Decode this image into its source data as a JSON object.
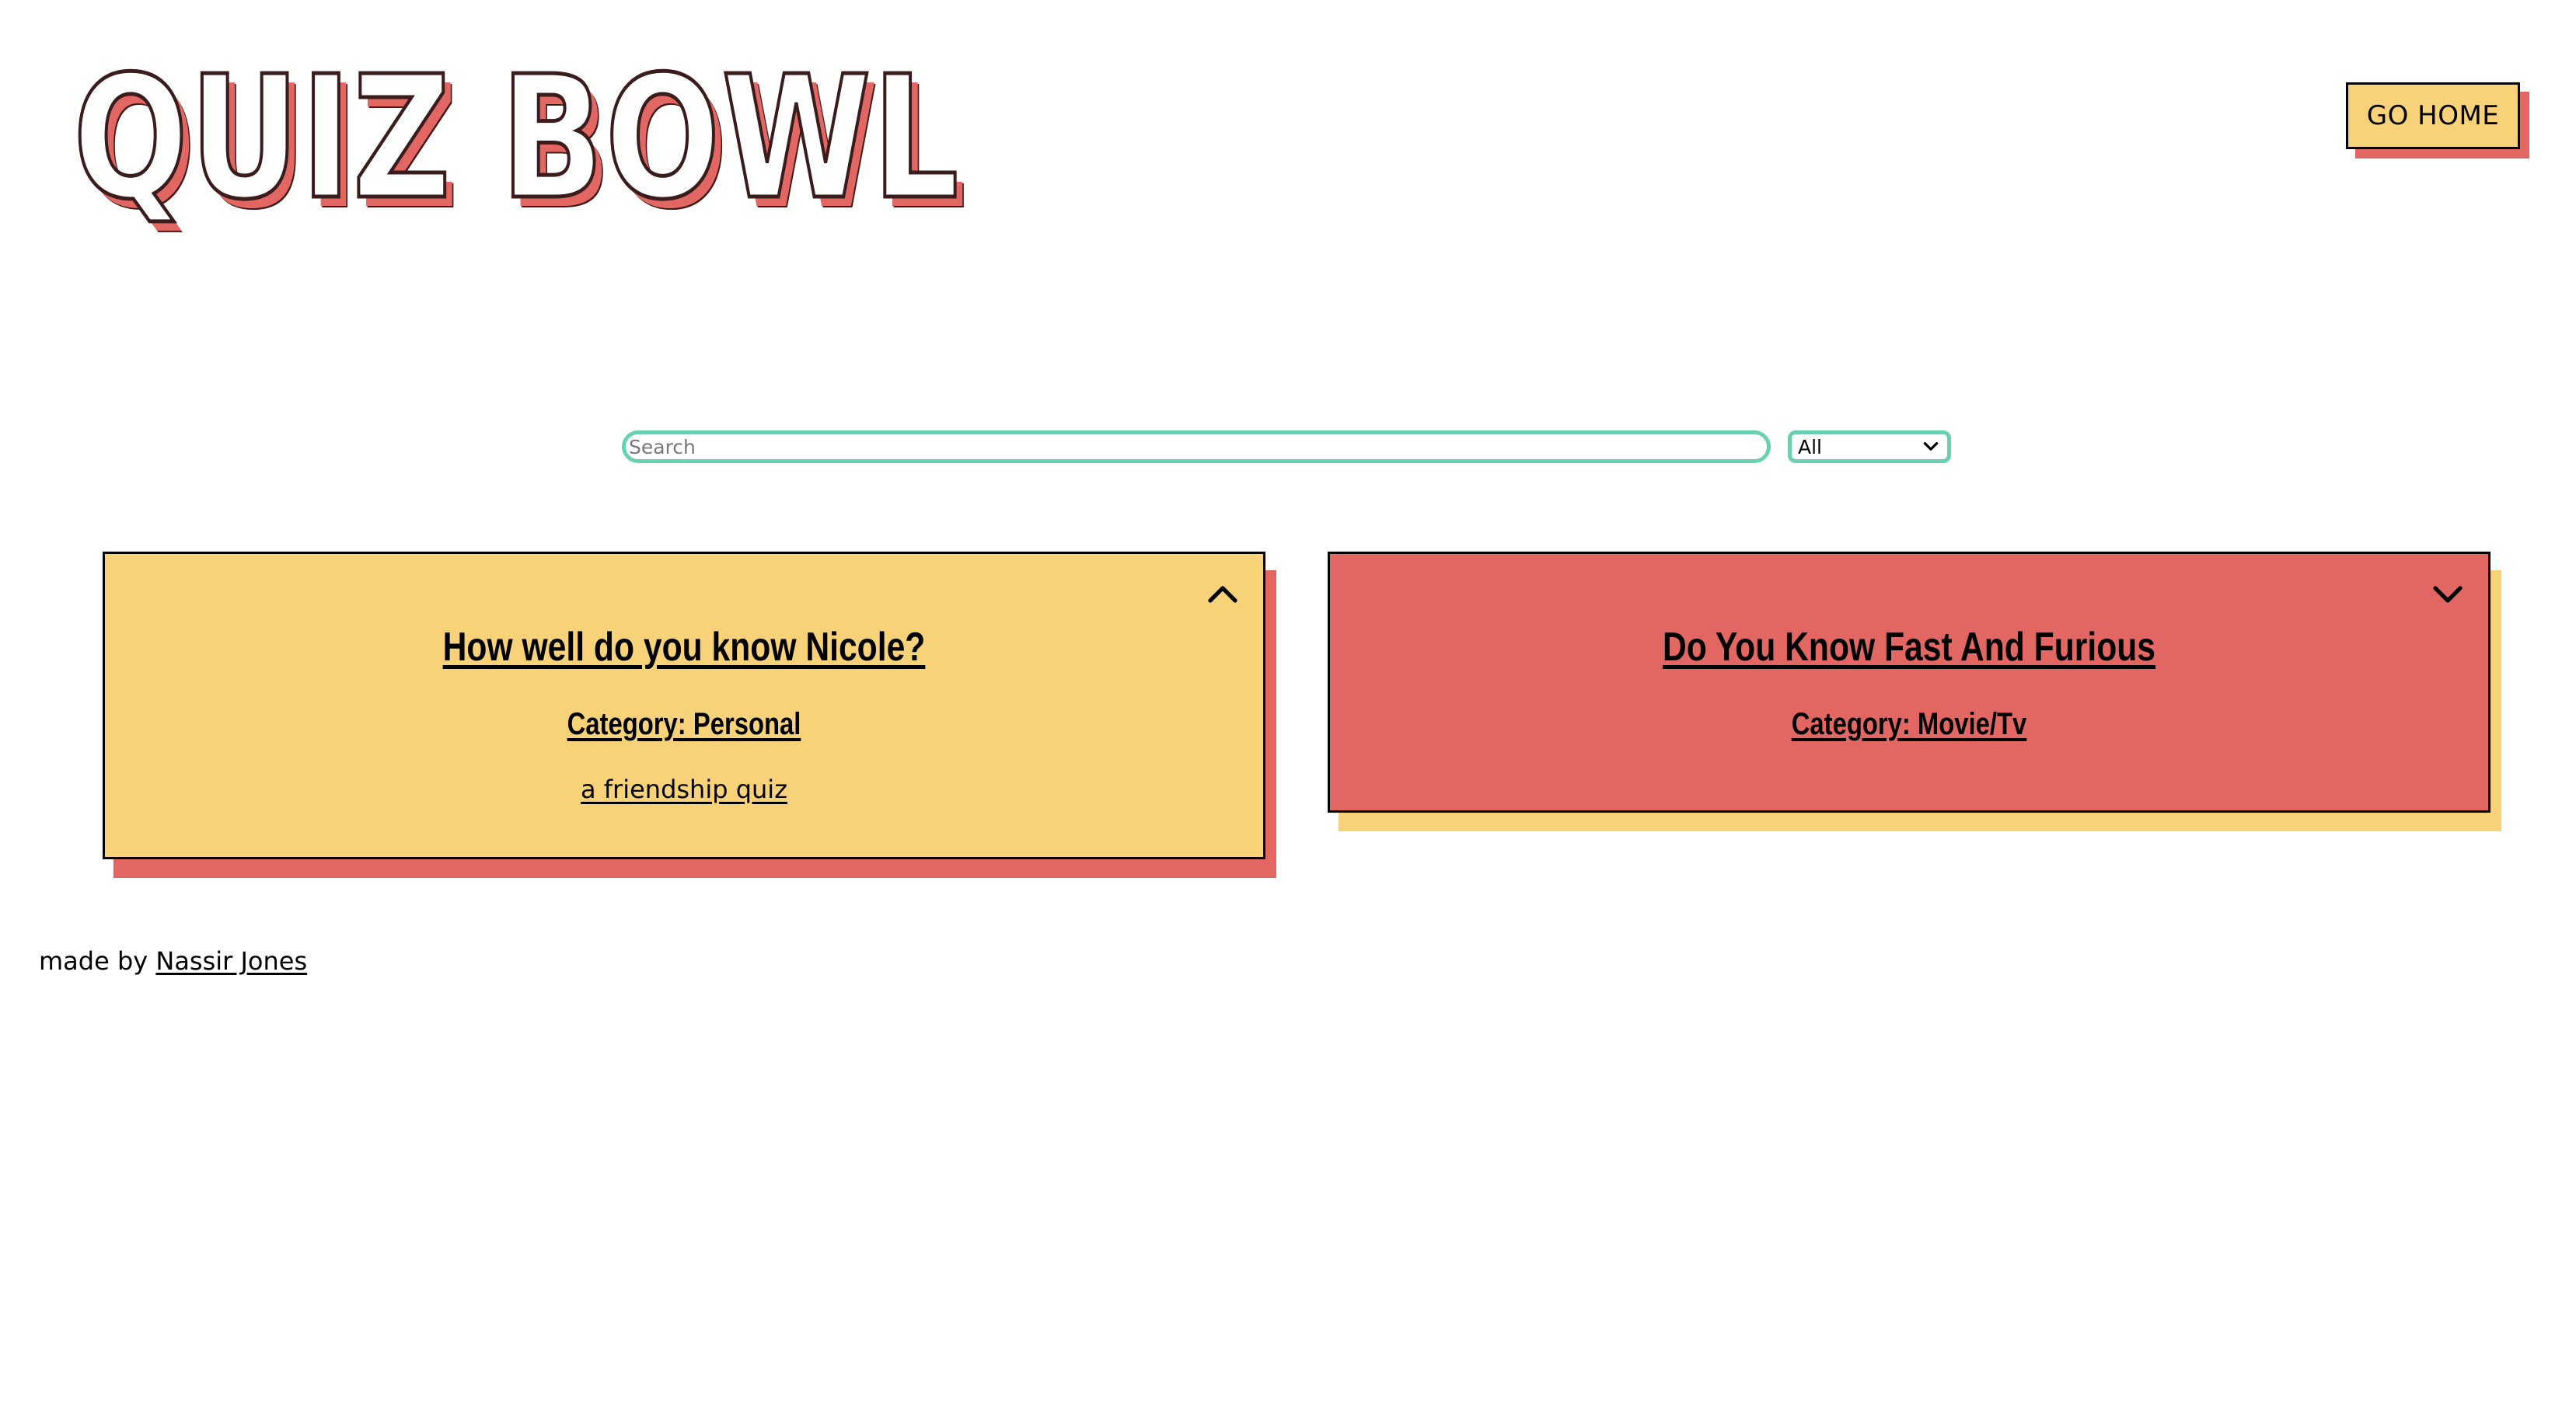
{
  "header": {
    "logo_text": "QUIZ BOWL",
    "home_button_label": "GO HOME"
  },
  "search": {
    "placeholder": "Search",
    "value": "",
    "filter_selected": "All"
  },
  "quizzes": [
    {
      "title": "How well do you know Nicole?",
      "category": "Category: Personal",
      "description": "a friendship quiz",
      "expanded": true,
      "toggle_icon": "chevron-up-icon",
      "card_color": "#f8d278",
      "shadow_color": "#e26763"
    },
    {
      "title": "Do You Know Fast And Furious",
      "category": "Category: Movie/Tv",
      "expanded": false,
      "toggle_icon": "chevron-down-icon",
      "card_color": "#e26763",
      "shadow_color": "#f8d278"
    }
  ],
  "footer": {
    "prefix": "made by",
    "author_link": "Nassir Jones"
  },
  "colors": {
    "accent_yellow": "#f8d278",
    "accent_red": "#e26763",
    "input_border": "#6ad1b0"
  }
}
